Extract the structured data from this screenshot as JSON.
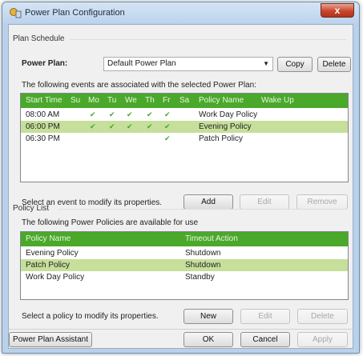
{
  "window": {
    "title": "Power Plan Configuration",
    "close_glyph": "x"
  },
  "schedule": {
    "group_label": "Plan Schedule",
    "power_plan_label": "Power Plan:",
    "power_plan_value": "Default Power Plan",
    "copy_label": "Copy",
    "delete_label": "Delete",
    "events_caption": "The following events are associated with the selected Power Plan:",
    "columns": [
      "Start Time",
      "Su",
      "Mo",
      "Tu",
      "We",
      "Th",
      "Fr",
      "Sa",
      "Policy Name",
      "Wake Up"
    ],
    "rows": [
      {
        "time": "08:00 AM",
        "days": [
          false,
          true,
          true,
          true,
          true,
          true,
          false
        ],
        "policy": "Work Day Policy",
        "selected": false
      },
      {
        "time": "06:00 PM",
        "days": [
          false,
          true,
          true,
          true,
          true,
          true,
          false
        ],
        "policy": "Evening Policy",
        "selected": true
      },
      {
        "time": "06:30 PM",
        "days": [
          false,
          false,
          false,
          false,
          false,
          true,
          false
        ],
        "policy": "Patch Policy",
        "selected": false
      }
    ],
    "check_glyph": "✔",
    "select_caption": "Select an event to modify its properties.",
    "add_label": "Add",
    "edit_label": "Edit",
    "remove_label": "Remove"
  },
  "policy": {
    "group_label": "Policy List",
    "caption": "The following Power Policies are available for use",
    "columns": [
      "Policy Name",
      "Timeout Action"
    ],
    "rows": [
      {
        "name": "Evening Policy",
        "action": "Shutdown",
        "selected": false
      },
      {
        "name": "Patch Policy",
        "action": "Shutdown",
        "selected": true
      },
      {
        "name": "Work Day Policy",
        "action": "Standby",
        "selected": false
      }
    ],
    "select_caption": "Select a policy to modify its properties.",
    "new_label": "New",
    "edit_label": "Edit",
    "delete_label": "Delete"
  },
  "footer": {
    "assistant_label": "Power Plan Assistant",
    "ok_label": "OK",
    "cancel_label": "Cancel",
    "apply_label": "Apply"
  },
  "colors": {
    "header_green": "#4aa82a",
    "selected_row": "#c6df9a",
    "check_green": "#43a52c"
  }
}
